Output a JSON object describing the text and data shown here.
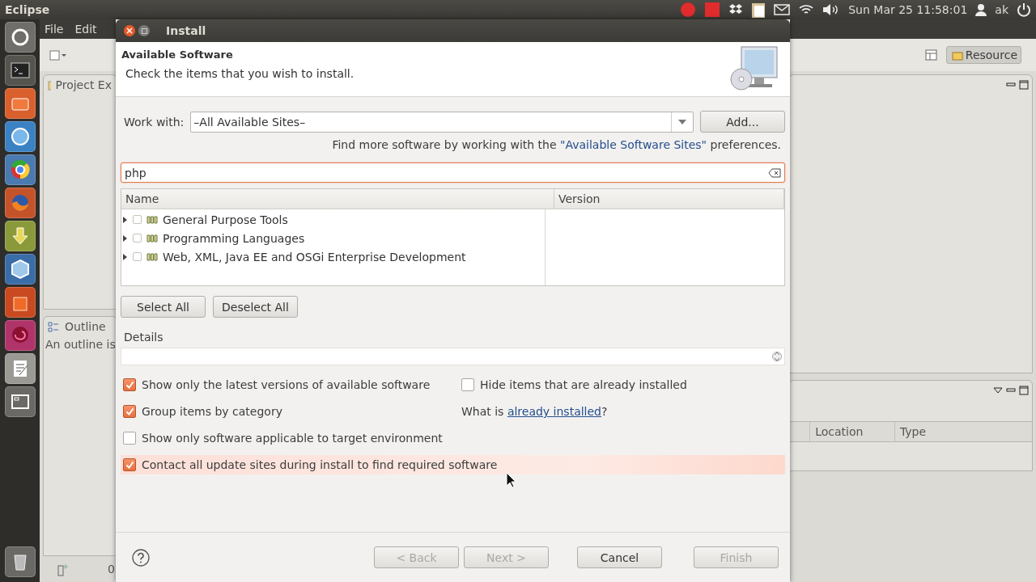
{
  "top_bar": {
    "app_name": "Eclipse",
    "clock": "Sun Mar 25 11:58:01",
    "user": "ak"
  },
  "eclipse": {
    "menu": [
      "File",
      "Edit"
    ],
    "perspective_button": "Resource",
    "project_tab": "Project Ex",
    "outline_tab": "Outline",
    "outline_message": "An outline is",
    "table_columns": [
      "Location",
      "Type"
    ],
    "status_text": "0"
  },
  "dialog": {
    "title": "Install",
    "heading": "Available Software",
    "description": "Check the items that you wish to install.",
    "work_with": {
      "label": "Work with:",
      "value": "–All Available Sites–"
    },
    "add_button": "Add...",
    "sites_hint": {
      "prefix": "Find more software by working with the ",
      "link": "\"Available Software Sites\"",
      "suffix": " preferences."
    },
    "filter": {
      "value": "php"
    },
    "tree": {
      "columns": [
        "Name",
        "Version"
      ],
      "rows": [
        {
          "label": "General Purpose Tools",
          "checked": false,
          "expanded": false
        },
        {
          "label": "Programming Languages",
          "checked": false,
          "expanded": false
        },
        {
          "label": "Web, XML, Java EE and OSGi Enterprise Development",
          "checked": false,
          "expanded": false
        }
      ]
    },
    "select_all": "Select All",
    "deselect_all": "Deselect All",
    "details_label": "Details",
    "options": [
      {
        "label": "Show only the latest versions of available software",
        "checked": true,
        "hovered": false
      },
      {
        "label": "Group items by category",
        "checked": true,
        "hovered": false
      },
      {
        "label": "Show only software applicable to target environment",
        "checked": false,
        "hovered": false
      },
      {
        "label": "Contact all update sites during install to find required software",
        "checked": true,
        "hovered": true
      }
    ],
    "hide_installed": {
      "label": "Hide items that are already installed",
      "checked": false
    },
    "installed_line": {
      "prefix": "What is ",
      "link": "already installed",
      "suffix": "?"
    },
    "footer_buttons": [
      {
        "label": "< Back",
        "disabled": true
      },
      {
        "label": "Next >",
        "disabled": true
      },
      {
        "label": "Cancel",
        "disabled": false
      },
      {
        "label": "Finish",
        "disabled": true
      }
    ]
  }
}
